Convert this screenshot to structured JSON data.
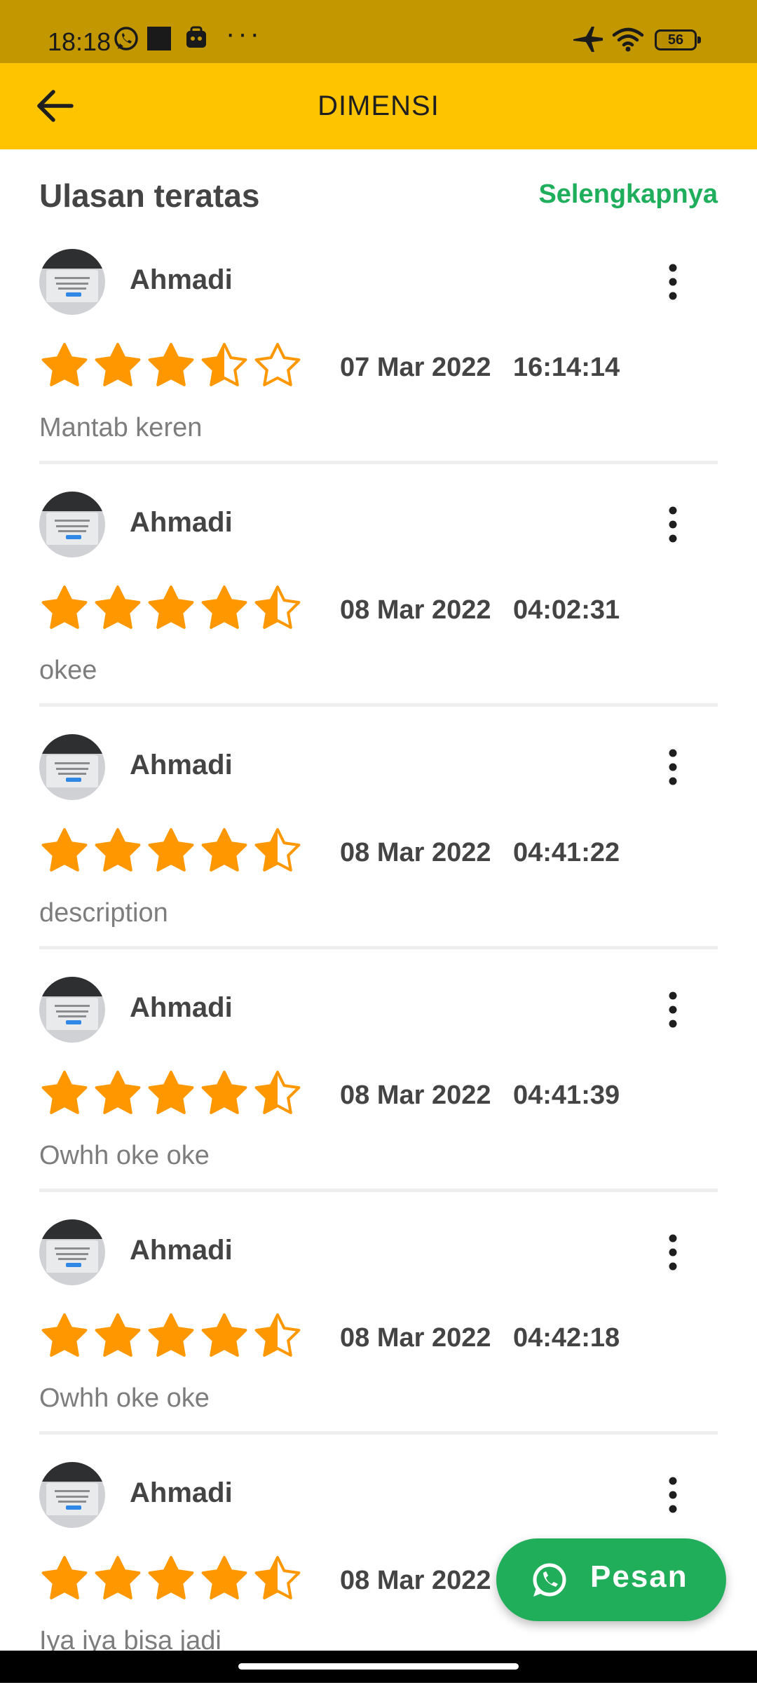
{
  "status_bar": {
    "time": "18:18",
    "battery": "56",
    "icons": [
      "whatsapp-icon",
      "square-app-icon",
      "app-icon",
      "more-notifications-icon",
      "airplane-mode-icon",
      "wifi-icon",
      "battery-icon"
    ]
  },
  "app_bar": {
    "title": "DIMENSI",
    "back_icon": "arrow-left-icon"
  },
  "section": {
    "title": "Ulasan teratas",
    "see_more": "Selengkapnya"
  },
  "colors": {
    "star": "#ff9800",
    "accent_green": "#1fae5b",
    "app_bar": "#ffc400"
  },
  "reviews": [
    {
      "name": "Ahmadi",
      "rating": 3.5,
      "date": "07 Mar 2022",
      "time": "16:14:14",
      "text": "Mantab keren"
    },
    {
      "name": "Ahmadi",
      "rating": 4.5,
      "date": "08 Mar 2022",
      "time": "04:02:31",
      "text": "okee"
    },
    {
      "name": "Ahmadi",
      "rating": 4.5,
      "date": "08 Mar 2022",
      "time": "04:41:22",
      "text": "description"
    },
    {
      "name": "Ahmadi",
      "rating": 4.5,
      "date": "08 Mar 2022",
      "time": "04:41:39",
      "text": "Owhh oke oke"
    },
    {
      "name": "Ahmadi",
      "rating": 4.5,
      "date": "08 Mar 2022",
      "time": "04:42:18",
      "text": "Owhh oke oke"
    },
    {
      "name": "Ahmadi",
      "rating": 4.5,
      "date": "08 Mar 2022",
      "time": "",
      "text": "Iya iya bisa jadi"
    }
  ],
  "fab": {
    "label": "Pesan",
    "icon": "whatsapp-icon"
  }
}
